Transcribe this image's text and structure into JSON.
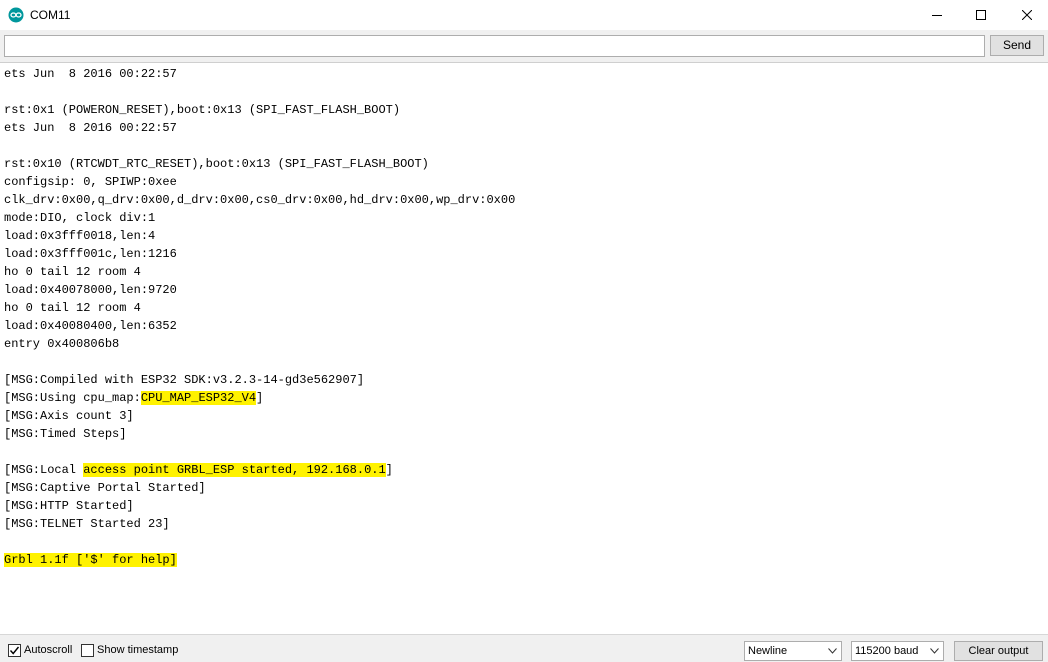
{
  "window": {
    "title": "COM11",
    "icon": "arduino-infinity-icon",
    "accent_color": "#00979c"
  },
  "toolbar": {
    "input_value": "",
    "send_label": "Send"
  },
  "output": {
    "highlight_color": "#fff200",
    "lines": [
      {
        "text": "ets Jun  8 2016 00:22:57"
      },
      {
        "text": ""
      },
      {
        "text": "rst:0x1 (POWERON_RESET),boot:0x13 (SPI_FAST_FLASH_BOOT)"
      },
      {
        "text": "ets Jun  8 2016 00:22:57"
      },
      {
        "text": ""
      },
      {
        "text": "rst:0x10 (RTCWDT_RTC_RESET),boot:0x13 (SPI_FAST_FLASH_BOOT)"
      },
      {
        "text": "configsip: 0, SPIWP:0xee"
      },
      {
        "text": "clk_drv:0x00,q_drv:0x00,d_drv:0x00,cs0_drv:0x00,hd_drv:0x00,wp_drv:0x00"
      },
      {
        "text": "mode:DIO, clock div:1"
      },
      {
        "text": "load:0x3fff0018,len:4"
      },
      {
        "text": "load:0x3fff001c,len:1216"
      },
      {
        "text": "ho 0 tail 12 room 4"
      },
      {
        "text": "load:0x40078000,len:9720"
      },
      {
        "text": "ho 0 tail 12 room 4"
      },
      {
        "text": "load:0x40080400,len:6352"
      },
      {
        "text": "entry 0x400806b8"
      },
      {
        "text": ""
      },
      {
        "text": "[MSG:Compiled with ESP32 SDK:v3.2.3-14-gd3e562907]"
      },
      {
        "text": "[MSG:Using cpu_map:",
        "hl": "CPU_MAP_ESP32_V4",
        "post": "]"
      },
      {
        "text": "[MSG:Axis count 3]"
      },
      {
        "text": "[MSG:Timed Steps]"
      },
      {
        "text": ""
      },
      {
        "text": "[MSG:Local ",
        "hl": "access point GRBL_ESP started, 192.168.0.1",
        "post": "]"
      },
      {
        "text": "[MSG:Captive Portal Started]"
      },
      {
        "text": "[MSG:HTTP Started]"
      },
      {
        "text": "[MSG:TELNET Started 23]"
      },
      {
        "text": ""
      },
      {
        "text": "",
        "hl": "Grbl 1.1f ['$' for help]",
        "post": ""
      }
    ]
  },
  "statusbar": {
    "autoscroll_label": "Autoscroll",
    "autoscroll_checked": true,
    "timestamp_label": "Show timestamp",
    "timestamp_checked": false,
    "line_ending": "Newline",
    "baud_rate": "115200 baud",
    "clear_label": "Clear output"
  }
}
